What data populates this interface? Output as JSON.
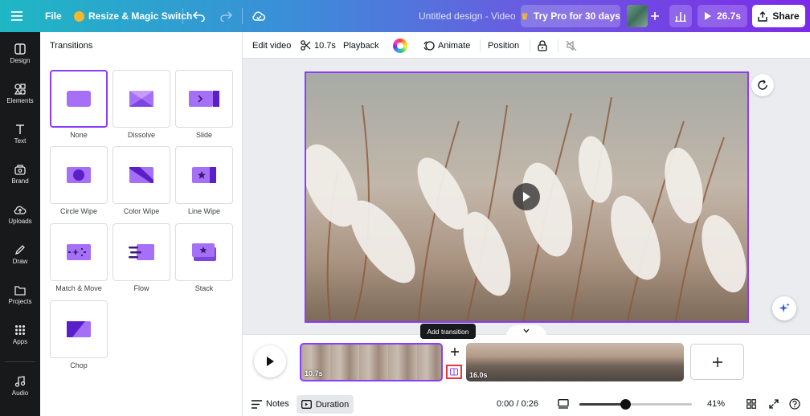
{
  "topbar": {
    "file_label": "File",
    "resize_label": "Resize & Magic Switch",
    "title": "Untitled design - Video",
    "try_pro_label": "Try Pro for 30 days",
    "duration_label": "26.7s",
    "share_label": "Share"
  },
  "rail": {
    "items": [
      {
        "label": "Design",
        "icon": "design-icon"
      },
      {
        "label": "Elements",
        "icon": "elements-icon"
      },
      {
        "label": "Text",
        "icon": "text-icon"
      },
      {
        "label": "Brand",
        "icon": "brand-icon"
      },
      {
        "label": "Uploads",
        "icon": "uploads-icon"
      },
      {
        "label": "Draw",
        "icon": "draw-icon"
      },
      {
        "label": "Projects",
        "icon": "projects-icon"
      },
      {
        "label": "Apps",
        "icon": "apps-icon"
      },
      {
        "label": "Audio",
        "icon": "audio-icon"
      }
    ]
  },
  "panel": {
    "title": "Transitions",
    "transitions": [
      {
        "label": "None"
      },
      {
        "label": "Dissolve"
      },
      {
        "label": "Slide"
      },
      {
        "label": "Circle Wipe"
      },
      {
        "label": "Color Wipe"
      },
      {
        "label": "Line Wipe"
      },
      {
        "label": "Match & Move"
      },
      {
        "label": "Flow"
      },
      {
        "label": "Stack"
      },
      {
        "label": "Chop"
      }
    ],
    "selected": "None"
  },
  "toolbar": {
    "edit_video": "Edit video",
    "trim_duration": "10.7s",
    "playback": "Playback",
    "animate": "Animate",
    "position": "Position"
  },
  "timeline": {
    "tooltip": "Add transition",
    "clip1_duration": "10.7s",
    "clip2_duration": "16.0s",
    "notes_label": "Notes",
    "duration_label": "Duration",
    "time_display": "0:00 / 0:26",
    "zoom": "41%",
    "zoom_fraction": 0.41
  },
  "colors": {
    "accent": "#8b3dff",
    "transition_fill": "#a570f5",
    "transition_dark": "#5a1fc9"
  }
}
